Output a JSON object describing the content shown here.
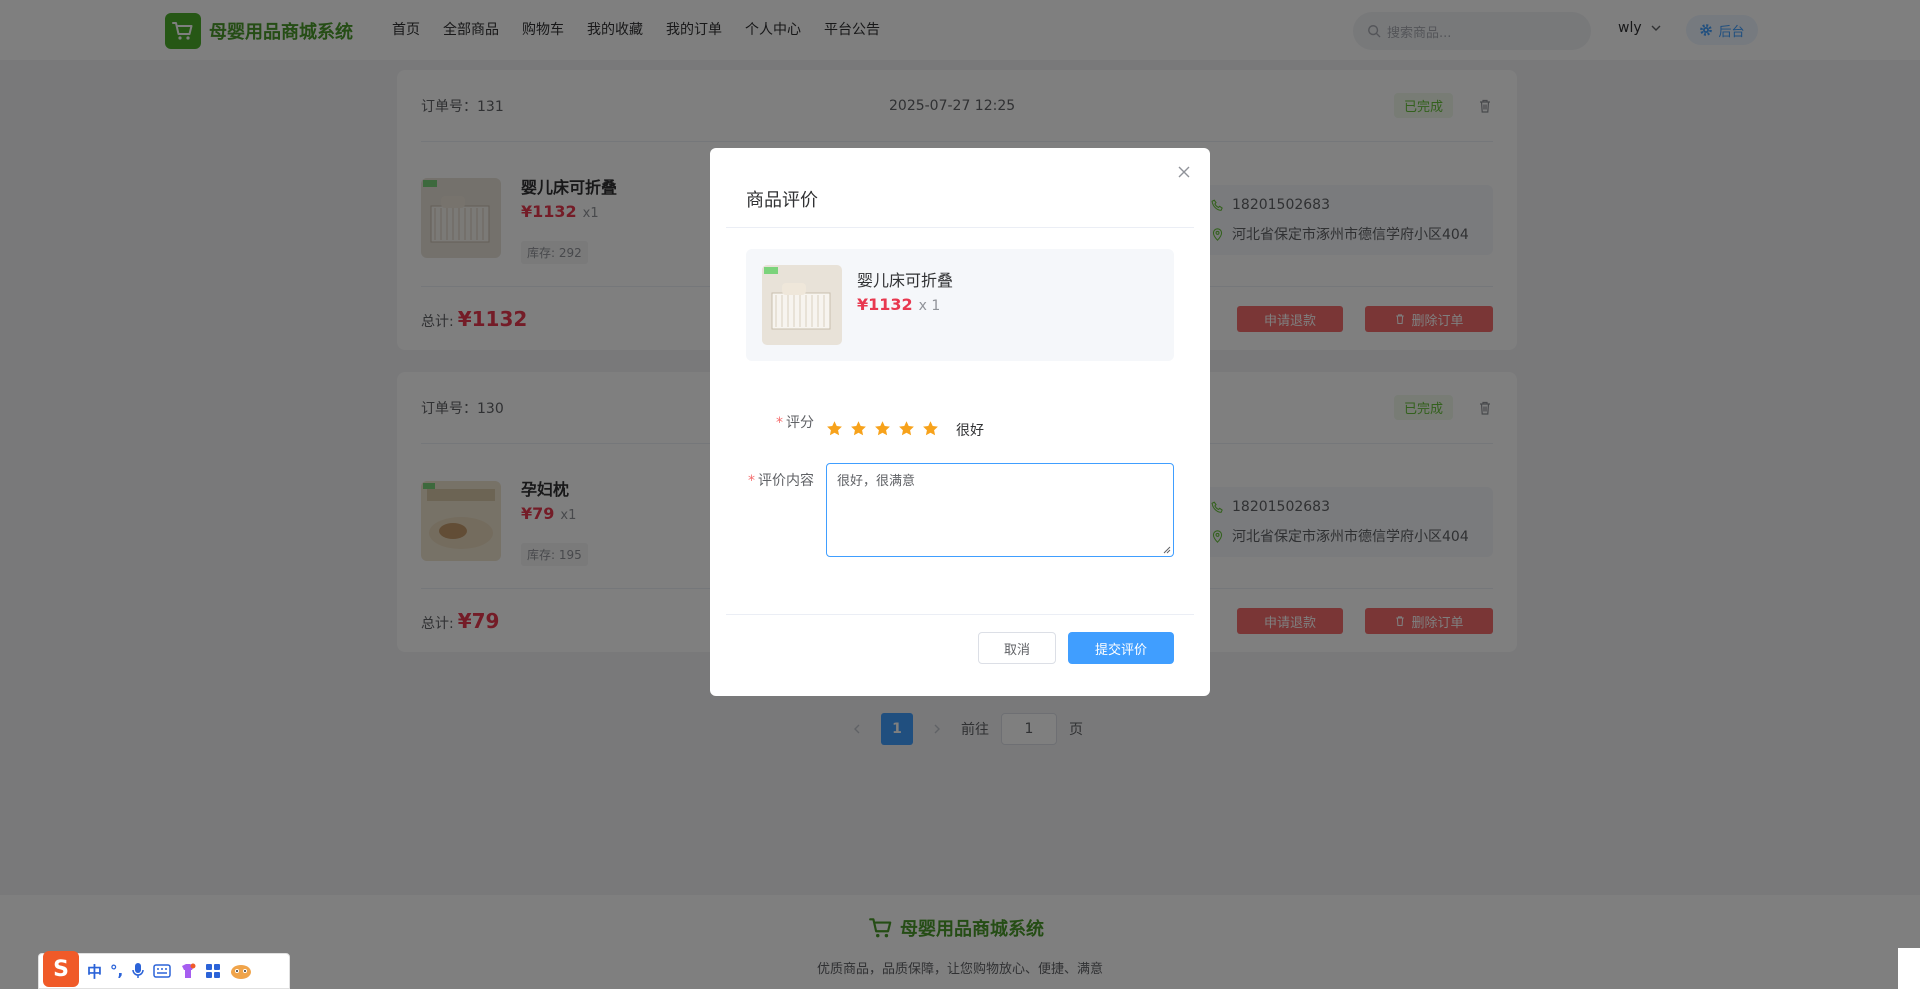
{
  "header": {
    "logo_text": "母婴用品商城系统",
    "nav": [
      "首页",
      "全部商品",
      "购物车",
      "我的收藏",
      "我的订单",
      "个人中心",
      "平台公告"
    ],
    "search_placeholder": "搜索商品...",
    "username": "wly",
    "admin_label": "后台"
  },
  "orders": [
    {
      "order_no": "订单号：131",
      "time": "2025-07-27 12:25",
      "status": "已完成",
      "product_name": "婴儿床可折叠",
      "price": "¥1132",
      "qty": "x1",
      "stock": "库存: 292",
      "phone": "18201502683",
      "address": "河北省保定市涿州市德信学府小区404",
      "total_label": "总计:",
      "total": "¥1132",
      "refund_label": "申请退款",
      "delete_label": "删除订单"
    },
    {
      "order_no": "订单号：130",
      "time": "",
      "status": "已完成",
      "product_name": "孕妇枕",
      "price": "¥79",
      "qty": "x1",
      "stock": "库存: 195",
      "phone": "18201502683",
      "address": "河北省保定市涿州市德信学府小区404",
      "total_label": "总计:",
      "total": "¥79",
      "refund_label": "申请退款",
      "delete_label": "删除订单"
    }
  ],
  "pagination": {
    "current": "1",
    "goto_label": "前往",
    "goto_value": "1",
    "page_suffix": "页"
  },
  "footer": {
    "logo_text": "母婴用品商城系统",
    "slogan": "优质商品，品质保障，让您购物放心、便捷、满意"
  },
  "dialog": {
    "title": "商品评价",
    "product_name": "婴儿床可折叠",
    "product_price": "¥1132",
    "product_qty": "x 1",
    "rating_label": "评分",
    "rating_value": 5,
    "rating_max": 5,
    "rating_text": "很好",
    "content_label": "评价内容",
    "content_value": "很好，很满意",
    "cancel_label": "取消",
    "submit_label": "提交评价"
  },
  "ime": {
    "items": [
      "中",
      "°,"
    ]
  },
  "colors": {
    "brand_green": "#4a9a2a",
    "accent_blue": "#409eff",
    "price_red": "#e8384f",
    "danger_red": "#f56c6c",
    "star_orange": "#f7a21b"
  }
}
